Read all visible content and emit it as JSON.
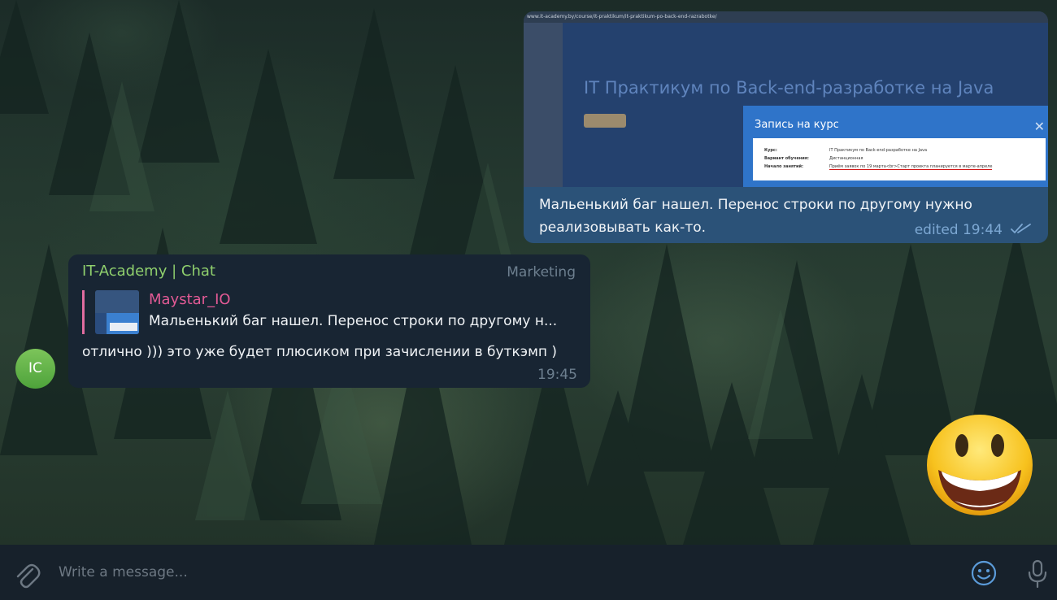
{
  "outgoing_message": {
    "screenshot": {
      "url": "www.it-academy.by/course/it-praktikum/it-praktikum-po-back-end-razrabotke/",
      "page_title": "IT Практикум по Back-end-разработке на Java",
      "modal_title": "Запись на курс",
      "rows": [
        {
          "label": "Курс:",
          "value": "IT Практикум по Back-end-разработке на Java"
        },
        {
          "label": "Вариант обучения:",
          "value": "Дистанционная"
        },
        {
          "label": "Начало занятий:",
          "value": "Приём заявок по 19 марта<br>Старт проекта планируется в марте-апреле"
        }
      ]
    },
    "text": "Мальенький баг нашел. Перенос строки по другому нужно реализовывать как-то.",
    "meta": "edited 19:44",
    "read_icon": "double-check-icon"
  },
  "incoming_message": {
    "sender": "IT-Academy | Chat",
    "tag": "Marketing",
    "reply": {
      "author": "Maystar_IO",
      "text": "Мальенький баг нашел. Перенос строки по другому н..."
    },
    "text": "отлично ))) это уже будет плюсиком при зачислении в буткэмп )",
    "time": "19:45",
    "avatar_initials": "IC"
  },
  "composer": {
    "placeholder": "Write a message...",
    "attach_icon": "paperclip-icon",
    "emoji_icon": "smiley-icon",
    "mic_icon": "microphone-icon"
  },
  "colors": {
    "outgoing_bubble": "#2b5278",
    "incoming_bubble": "#182533",
    "sender_name": "#8fcf6d",
    "reply_author": "#e25a95",
    "composer_bg": "#17212b"
  }
}
